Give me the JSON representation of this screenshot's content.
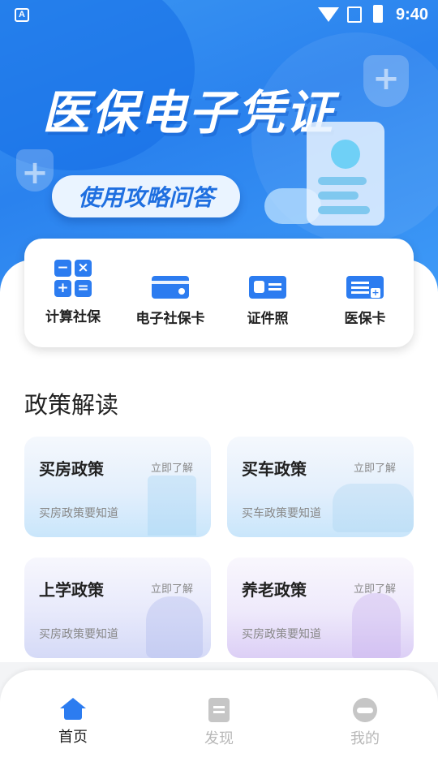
{
  "status_bar": {
    "time": "9:40",
    "app_icon_letter": "A"
  },
  "banner": {
    "title": "医保电子凭证",
    "pill": "使用攻略问答"
  },
  "quick_actions": [
    {
      "label": "计算社保",
      "icon": "calculator-icon"
    },
    {
      "label": "电子社保卡",
      "icon": "social-security-card-icon"
    },
    {
      "label": "证件照",
      "icon": "id-photo-icon"
    },
    {
      "label": "医保卡",
      "icon": "medical-insurance-card-icon"
    }
  ],
  "calc_symbols": [
    "−",
    "×",
    "+",
    "="
  ],
  "section": {
    "title": "政策解读"
  },
  "policies": [
    {
      "title": "买房政策",
      "link": "立即了解",
      "subtitle": "买房政策要知道"
    },
    {
      "title": "买车政策",
      "link": "立即了解",
      "subtitle": "买车政策要知道"
    },
    {
      "title": "上学政策",
      "link": "立即了解",
      "subtitle": "买房政策要知道"
    },
    {
      "title": "养老政策",
      "link": "立即了解",
      "subtitle": "买房政策要知道"
    }
  ],
  "bottom_nav": [
    {
      "label": "首页",
      "icon": "home-icon",
      "active": true
    },
    {
      "label": "发现",
      "icon": "discover-icon",
      "active": false
    },
    {
      "label": "我的",
      "icon": "profile-icon",
      "active": false
    }
  ],
  "colors": {
    "accent": "#2c7cf0",
    "banner": "#2a82ee"
  }
}
